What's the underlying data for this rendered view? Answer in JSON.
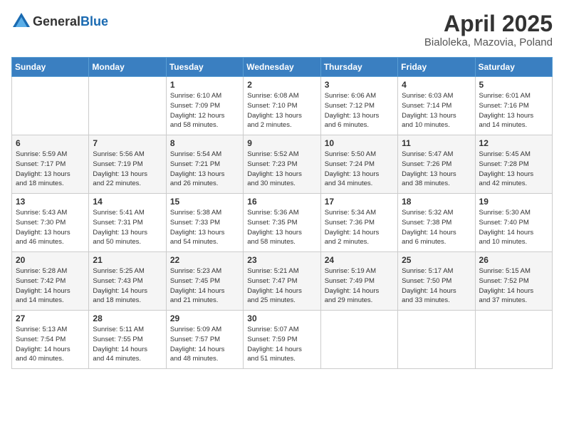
{
  "header": {
    "logo_general": "General",
    "logo_blue": "Blue",
    "title": "April 2025",
    "subtitle": "Bialoleka, Mazovia, Poland"
  },
  "weekdays": [
    "Sunday",
    "Monday",
    "Tuesday",
    "Wednesday",
    "Thursday",
    "Friday",
    "Saturday"
  ],
  "weeks": [
    [
      {
        "day": "",
        "info": ""
      },
      {
        "day": "",
        "info": ""
      },
      {
        "day": "1",
        "info": "Sunrise: 6:10 AM\nSunset: 7:09 PM\nDaylight: 12 hours\nand 58 minutes."
      },
      {
        "day": "2",
        "info": "Sunrise: 6:08 AM\nSunset: 7:10 PM\nDaylight: 13 hours\nand 2 minutes."
      },
      {
        "day": "3",
        "info": "Sunrise: 6:06 AM\nSunset: 7:12 PM\nDaylight: 13 hours\nand 6 minutes."
      },
      {
        "day": "4",
        "info": "Sunrise: 6:03 AM\nSunset: 7:14 PM\nDaylight: 13 hours\nand 10 minutes."
      },
      {
        "day": "5",
        "info": "Sunrise: 6:01 AM\nSunset: 7:16 PM\nDaylight: 13 hours\nand 14 minutes."
      }
    ],
    [
      {
        "day": "6",
        "info": "Sunrise: 5:59 AM\nSunset: 7:17 PM\nDaylight: 13 hours\nand 18 minutes."
      },
      {
        "day": "7",
        "info": "Sunrise: 5:56 AM\nSunset: 7:19 PM\nDaylight: 13 hours\nand 22 minutes."
      },
      {
        "day": "8",
        "info": "Sunrise: 5:54 AM\nSunset: 7:21 PM\nDaylight: 13 hours\nand 26 minutes."
      },
      {
        "day": "9",
        "info": "Sunrise: 5:52 AM\nSunset: 7:23 PM\nDaylight: 13 hours\nand 30 minutes."
      },
      {
        "day": "10",
        "info": "Sunrise: 5:50 AM\nSunset: 7:24 PM\nDaylight: 13 hours\nand 34 minutes."
      },
      {
        "day": "11",
        "info": "Sunrise: 5:47 AM\nSunset: 7:26 PM\nDaylight: 13 hours\nand 38 minutes."
      },
      {
        "day": "12",
        "info": "Sunrise: 5:45 AM\nSunset: 7:28 PM\nDaylight: 13 hours\nand 42 minutes."
      }
    ],
    [
      {
        "day": "13",
        "info": "Sunrise: 5:43 AM\nSunset: 7:30 PM\nDaylight: 13 hours\nand 46 minutes."
      },
      {
        "day": "14",
        "info": "Sunrise: 5:41 AM\nSunset: 7:31 PM\nDaylight: 13 hours\nand 50 minutes."
      },
      {
        "day": "15",
        "info": "Sunrise: 5:38 AM\nSunset: 7:33 PM\nDaylight: 13 hours\nand 54 minutes."
      },
      {
        "day": "16",
        "info": "Sunrise: 5:36 AM\nSunset: 7:35 PM\nDaylight: 13 hours\nand 58 minutes."
      },
      {
        "day": "17",
        "info": "Sunrise: 5:34 AM\nSunset: 7:36 PM\nDaylight: 14 hours\nand 2 minutes."
      },
      {
        "day": "18",
        "info": "Sunrise: 5:32 AM\nSunset: 7:38 PM\nDaylight: 14 hours\nand 6 minutes."
      },
      {
        "day": "19",
        "info": "Sunrise: 5:30 AM\nSunset: 7:40 PM\nDaylight: 14 hours\nand 10 minutes."
      }
    ],
    [
      {
        "day": "20",
        "info": "Sunrise: 5:28 AM\nSunset: 7:42 PM\nDaylight: 14 hours\nand 14 minutes."
      },
      {
        "day": "21",
        "info": "Sunrise: 5:25 AM\nSunset: 7:43 PM\nDaylight: 14 hours\nand 18 minutes."
      },
      {
        "day": "22",
        "info": "Sunrise: 5:23 AM\nSunset: 7:45 PM\nDaylight: 14 hours\nand 21 minutes."
      },
      {
        "day": "23",
        "info": "Sunrise: 5:21 AM\nSunset: 7:47 PM\nDaylight: 14 hours\nand 25 minutes."
      },
      {
        "day": "24",
        "info": "Sunrise: 5:19 AM\nSunset: 7:49 PM\nDaylight: 14 hours\nand 29 minutes."
      },
      {
        "day": "25",
        "info": "Sunrise: 5:17 AM\nSunset: 7:50 PM\nDaylight: 14 hours\nand 33 minutes."
      },
      {
        "day": "26",
        "info": "Sunrise: 5:15 AM\nSunset: 7:52 PM\nDaylight: 14 hours\nand 37 minutes."
      }
    ],
    [
      {
        "day": "27",
        "info": "Sunrise: 5:13 AM\nSunset: 7:54 PM\nDaylight: 14 hours\nand 40 minutes."
      },
      {
        "day": "28",
        "info": "Sunrise: 5:11 AM\nSunset: 7:55 PM\nDaylight: 14 hours\nand 44 minutes."
      },
      {
        "day": "29",
        "info": "Sunrise: 5:09 AM\nSunset: 7:57 PM\nDaylight: 14 hours\nand 48 minutes."
      },
      {
        "day": "30",
        "info": "Sunrise: 5:07 AM\nSunset: 7:59 PM\nDaylight: 14 hours\nand 51 minutes."
      },
      {
        "day": "",
        "info": ""
      },
      {
        "day": "",
        "info": ""
      },
      {
        "day": "",
        "info": ""
      }
    ]
  ]
}
